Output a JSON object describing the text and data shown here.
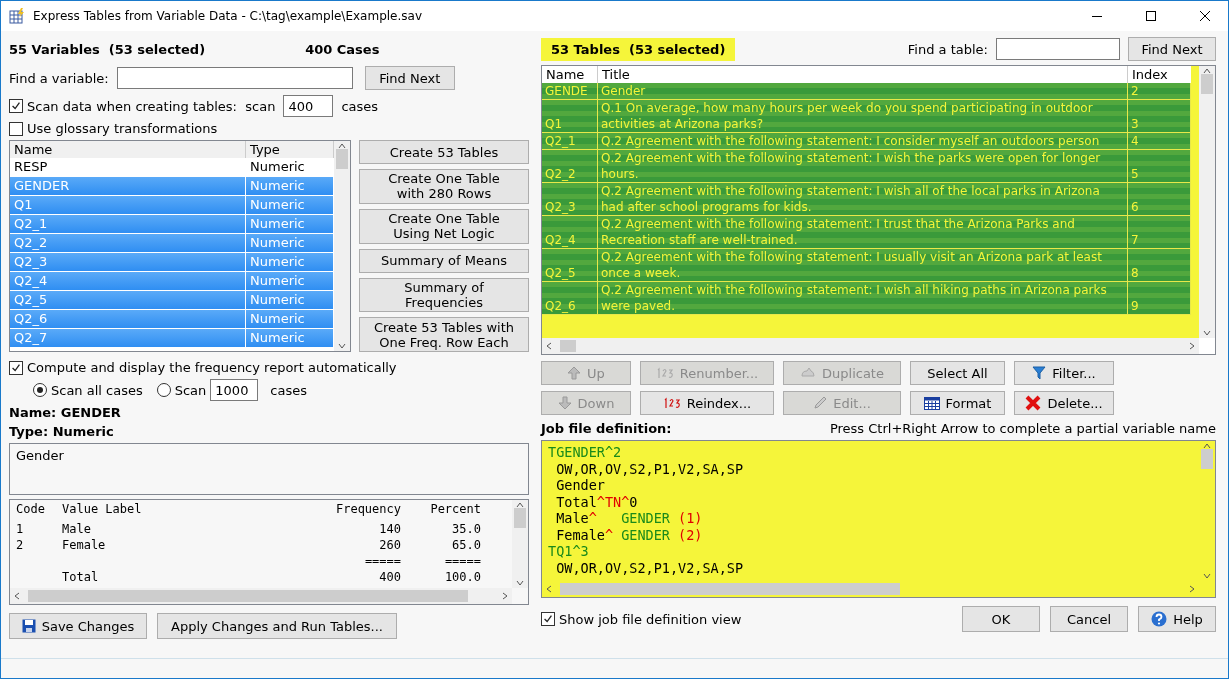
{
  "window": {
    "title": "Express Tables from Variable Data - C:\\tag\\example\\Example.sav"
  },
  "variables_panel": {
    "heading": "55 Variables  (53 selected)",
    "cases": "400 Cases",
    "find": {
      "label": "Find a variable:",
      "button": "Find Next"
    },
    "scan_option": {
      "label": "Scan data when creating tables:  scan",
      "checked": true,
      "value": "400",
      "suffix": "cases"
    },
    "glossary_option": {
      "label": "Use glossary transformations",
      "checked": false
    },
    "columns": [
      "Name",
      "Type"
    ],
    "rows": [
      {
        "name": "RESP",
        "type": "Numeric",
        "selected": false
      },
      {
        "name": "GENDER",
        "type": "Numeric",
        "selected": true
      },
      {
        "name": "Q1",
        "type": "Numeric",
        "selected": true
      },
      {
        "name": "Q2_1",
        "type": "Numeric",
        "selected": true
      },
      {
        "name": "Q2_2",
        "type": "Numeric",
        "selected": true
      },
      {
        "name": "Q2_3",
        "type": "Numeric",
        "selected": true
      },
      {
        "name": "Q2_4",
        "type": "Numeric",
        "selected": true
      },
      {
        "name": "Q2_5",
        "type": "Numeric",
        "selected": true
      },
      {
        "name": "Q2_6",
        "type": "Numeric",
        "selected": true
      },
      {
        "name": "Q2_7",
        "type": "Numeric",
        "selected": true
      }
    ],
    "actions": [
      "Create 53 Tables",
      "Create One Table\nwith 280 Rows",
      "Create One Table\nUsing Net Logic",
      "Summary of Means",
      "Summary of Frequencies",
      "Create 53 Tables with\nOne Freq. Row Each"
    ],
    "frequency_option": {
      "label": "Compute and display the frequency report automatically",
      "checked": true
    },
    "scan_modes": [
      {
        "label": "Scan all cases",
        "selected": true
      },
      {
        "label": "Scan",
        "selected": false
      }
    ],
    "scan_count": {
      "value": "1000",
      "suffix": "cases"
    },
    "name_line": "Name: GENDER",
    "type_line": "Type: Numeric",
    "variable_label": "Gender",
    "frequency_table": {
      "columns": [
        "Code",
        "Value Label",
        "Frequency",
        "Percent"
      ],
      "rows": [
        [
          "1",
          "Male",
          "140",
          "35.0"
        ],
        [
          "2",
          "Female",
          "260",
          "65.0"
        ],
        [
          "",
          "",
          "=====",
          "====="
        ],
        [
          "",
          "Total",
          "400",
          "100.0"
        ]
      ]
    },
    "buttons": [
      "Save Changes",
      "Apply Changes and Run Tables..."
    ]
  },
  "tables_panel": {
    "heading": "53 Tables  (53 selected)",
    "find": {
      "label": "Find a table:",
      "button": "Find Next"
    },
    "columns": [
      "Name",
      "Title",
      "Index"
    ],
    "rows": [
      {
        "name": "GENDE",
        "title": "Gender",
        "index": "2",
        "selected": true
      },
      {
        "name": "Q1",
        "title": "Q.1 On average, how many hours per week do you spend participating in outdoor activities at Arizona parks?",
        "index": "3",
        "selected": true
      },
      {
        "name": "Q2_1",
        "title": "Q.2 Agreement with the following statement: I consider myself an outdoors person",
        "index": "4",
        "selected": true
      },
      {
        "name": "Q2_2",
        "title": "Q.2 Agreement with the following statement: I wish the parks were open for longer hours.",
        "index": "5",
        "selected": true
      },
      {
        "name": "Q2_3",
        "title": "Q.2 Agreement with the following statement: I wish all of the local parks in Arizona had after school programs for kids.",
        "index": "6",
        "selected": true
      },
      {
        "name": "Q2_4",
        "title": "Q.2 Agreement with the following statement: I trust that the Arizona Parks and Recreation staff are well-trained.",
        "index": "7",
        "selected": true
      },
      {
        "name": "Q2_5",
        "title": "Q.2 Agreement with the following statement: I usually visit an Arizona park at least once a week.",
        "index": "8",
        "selected": true
      },
      {
        "name": "Q2_6",
        "title": "Q.2 Agreement with the following statement: I wish all hiking paths in Arizona parks were paved.",
        "index": "9",
        "selected": true
      }
    ],
    "toolbar": [
      {
        "label": "Up",
        "disabled": true
      },
      {
        "label": "Renumber...",
        "disabled": true
      },
      {
        "label": "Duplicate",
        "disabled": true
      },
      {
        "label": "Select All",
        "disabled": false
      },
      {
        "label": "Filter...",
        "disabled": false
      },
      {
        "label": "Down",
        "disabled": true
      },
      {
        "label": "Reindex...",
        "disabled": false
      },
      {
        "label": "Edit...",
        "disabled": true
      },
      {
        "label": "Format",
        "disabled": false
      },
      {
        "label": "Delete...",
        "disabled": false
      }
    ],
    "job_label": "Job file definition:",
    "job_hint": "Press Ctrl+Right Arrow to complete a partial variable name",
    "job_lines": [
      [
        {
          "text": "TGENDER^2",
          "kind": "code"
        }
      ],
      [
        {
          "text": " OW,OR,OV,S2,P1,V2,SA,SP",
          "kind": "text"
        }
      ],
      [
        {
          "text": " Gender",
          "kind": "text"
        }
      ],
      [
        {
          "text": " Total",
          "kind": "text"
        },
        {
          "text": "^TN^",
          "kind": "mark"
        },
        {
          "text": "0",
          "kind": "text"
        }
      ],
      [
        {
          "text": " Male",
          "kind": "text"
        },
        {
          "text": "^",
          "kind": "mark"
        },
        {
          "text": "   GENDER ",
          "kind": "code"
        },
        {
          "text": "(1)",
          "kind": "mark"
        }
      ],
      [
        {
          "text": " Female",
          "kind": "text"
        },
        {
          "text": "^",
          "kind": "mark"
        },
        {
          "text": " GENDER ",
          "kind": "code"
        },
        {
          "text": "(2)",
          "kind": "mark"
        }
      ],
      [
        {
          "text": "TQ1^3",
          "kind": "code"
        }
      ],
      [
        {
          "text": " OW,OR,OV,S2,P1,V2,SA,SP",
          "kind": "text"
        }
      ]
    ],
    "show_job_view": {
      "label": "Show job file definition view",
      "checked": true
    },
    "buttons": [
      "OK",
      "Cancel",
      "Help"
    ]
  }
}
